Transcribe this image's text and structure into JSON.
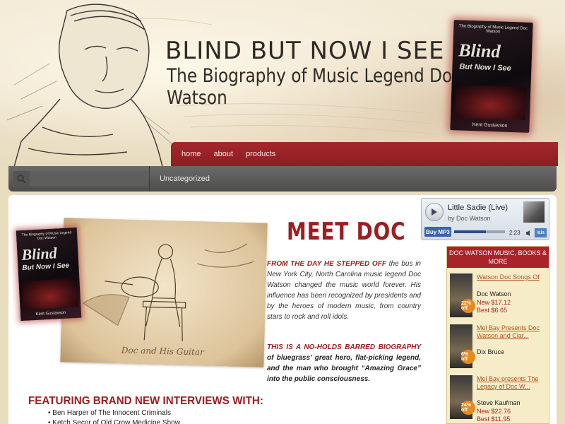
{
  "header": {
    "title": "BLIND BUT NOW I SEE",
    "subtitle": "The Biography of Music Legend Doc Watson",
    "book": {
      "top_text": "The Biography of Music Legend Doc Watson",
      "title_line1": "Blind",
      "title_line2": "But Now I See",
      "author": "Kent Gustavson"
    }
  },
  "nav": {
    "items": [
      {
        "label": "home"
      },
      {
        "label": "about"
      },
      {
        "label": "products"
      }
    ]
  },
  "subnav": {
    "search_placeholder": "",
    "category": "Uncategorized"
  },
  "feature": {
    "caption": "Doc and His Guitar"
  },
  "main": {
    "heading": "MEET DOC",
    "intro_lead": "FROM THE DAY HE STEPPED OFF",
    "intro_rest": " the bus in New York City, North Carolina music legend Doc Watson changed the music world forever. His influence has been recognized by presidents and by the heroes of modern music, from country stars to rock and roll idols.",
    "bio_lead": "THIS IS A NO-HOLDS BARRED BIOGRAPHY",
    "bio_rest": " of bluegrass' great hero, flat-picking legend, and the man who brought “Amazing Grace” into the public consciousness.",
    "featuring_heading": "FEATURING BRAND NEW INTERVIEWS WITH:",
    "featuring": [
      "Ben Harper of The Innocent Criminals",
      "Ketch Secor of Old Crow Medicine Show"
    ]
  },
  "player": {
    "song": "Little Sadie (Live)",
    "artist": "by Doc Watson",
    "buy_label": "Buy MP3",
    "time": "2:23",
    "progress": 0.62,
    "brand": "lala"
  },
  "store": {
    "heading": "DOC WATSON MUSIC, BOOKS & MORE",
    "items": [
      {
        "title": "Watson Doc Songs Of",
        "author": "Doc Watson",
        "price_new": "New $17.12",
        "price_best": "Best $6.65",
        "badge": "22% off"
      },
      {
        "title": "Mel Bay Presents Doc Watson and Clar...",
        "author": "Dix Bruce",
        "price_new": "",
        "price_best": "",
        "badge": "6% off"
      },
      {
        "title": "Mel Bay presents The Legacy of Doc W...",
        "author": "Steve Kaufman",
        "price_new": "New $22.76",
        "price_best": "Best $11.95",
        "badge": "24% off"
      }
    ]
  },
  "colors": {
    "accent_red": "#9b1f21",
    "nav_red": "#a3282c",
    "dark_bar": "#5a5a5a",
    "parchment": "#e9ddc0"
  }
}
